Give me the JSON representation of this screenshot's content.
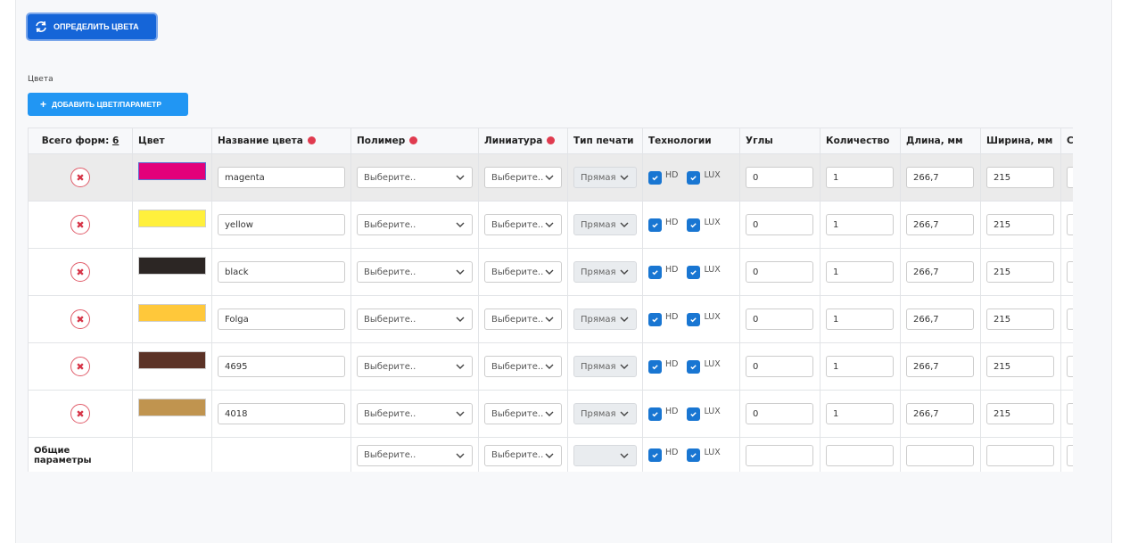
{
  "toolbar": {
    "detect_label": "ОПРЕДЕЛИТЬ ЦВЕТА"
  },
  "section": {
    "label": "Цвета",
    "add_label": "ДОБАВИТЬ ЦВЕТ/ПАРАМЕТР"
  },
  "table": {
    "total_label": "Всего форм:",
    "total_count": "6",
    "headers": {
      "color": "Цвет",
      "name": "Название цвета",
      "polymer": "Полимер",
      "lineature": "Линиатура",
      "print_type": "Тип печати",
      "tech": "Технологии",
      "angles": "Углы",
      "qty": "Количество",
      "length": "Длина, мм",
      "width": "Ширина, мм",
      "next": "С"
    },
    "rows": [
      {
        "swatch": "#e2007a",
        "name": "magenta",
        "polymer": "Выберите..",
        "lineature": "Выберите..",
        "print_type": "Прямая",
        "hd": "HD",
        "lux": "LUX",
        "angles": "0",
        "qty": "1",
        "length": "266,7",
        "width": "215"
      },
      {
        "swatch": "#fff03c",
        "name": "yellow",
        "polymer": "Выберите..",
        "lineature": "Выберите..",
        "print_type": "Прямая",
        "hd": "HD",
        "lux": "LUX",
        "angles": "0",
        "qty": "1",
        "length": "266,7",
        "width": "215"
      },
      {
        "swatch": "#2c2624",
        "name": "black",
        "polymer": "Выберите..",
        "lineature": "Выберите..",
        "print_type": "Прямая",
        "hd": "HD",
        "lux": "LUX",
        "angles": "0",
        "qty": "1",
        "length": "266,7",
        "width": "215"
      },
      {
        "swatch": "#ffc83a",
        "name": "Folga",
        "polymer": "Выберите..",
        "lineature": "Выберите..",
        "print_type": "Прямая",
        "hd": "HD",
        "lux": "LUX",
        "angles": "0",
        "qty": "1",
        "length": "266,7",
        "width": "215"
      },
      {
        "swatch": "#5b3226",
        "name": "4695",
        "polymer": "Выберите..",
        "lineature": "Выберите..",
        "print_type": "Прямая",
        "hd": "HD",
        "lux": "LUX",
        "angles": "0",
        "qty": "1",
        "length": "266,7",
        "width": "215"
      },
      {
        "swatch": "#c0944f",
        "name": "4018",
        "polymer": "Выберите..",
        "lineature": "Выберите..",
        "print_type": "Прямая",
        "hd": "HD",
        "lux": "LUX",
        "angles": "0",
        "qty": "1",
        "length": "266,7",
        "width": "215"
      }
    ],
    "footer": {
      "label": "Общие параметры",
      "polymer": "Выберите..",
      "lineature": "Выберите..",
      "print_type": "",
      "hd": "HD",
      "lux": "LUX",
      "angles": "",
      "qty": "",
      "length": "",
      "width": ""
    }
  },
  "colors": {
    "primary": "#1565d8",
    "accent": "#2196f3",
    "danger": "#e03b4f",
    "checkbox": "#1976d2"
  },
  "icons": {
    "detect": "refresh-icon",
    "add": "plus-icon",
    "delete": "close-icon",
    "dropdown": "chevron-down-icon",
    "check": "check-icon"
  }
}
